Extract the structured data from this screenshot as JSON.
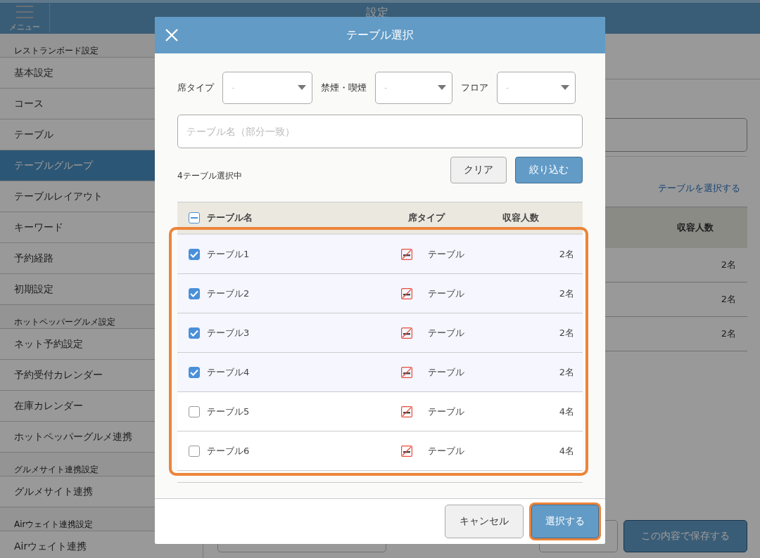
{
  "app_bar": {
    "menu_label": "メニュー",
    "title": "設定"
  },
  "sidebar": {
    "sections": [
      {
        "title": "レストランボード設定",
        "items": [
          {
            "label": "基本設定",
            "selected": false
          },
          {
            "label": "コース",
            "selected": false
          },
          {
            "label": "テーブル",
            "selected": false
          },
          {
            "label": "テーブルグループ",
            "selected": true
          },
          {
            "label": "テーブルレイアウト",
            "selected": false
          },
          {
            "label": "キーワード",
            "selected": false
          },
          {
            "label": "予約経路",
            "selected": false
          },
          {
            "label": "初期設定",
            "selected": false
          }
        ]
      },
      {
        "title": "ホットペッパーグルメ設定",
        "items": [
          {
            "label": "ネット予約設定",
            "selected": false
          },
          {
            "label": "予約受付カレンダー",
            "selected": false
          },
          {
            "label": "在庫カレンダー",
            "selected": false
          },
          {
            "label": "ホットペッパーグルメ連携",
            "selected": false
          }
        ]
      },
      {
        "title": "グルメサイト連携設定",
        "items": [
          {
            "label": "グルメサイト連携",
            "selected": false
          }
        ]
      },
      {
        "title": "Airウェイト連携設定",
        "items": [
          {
            "label": "Airウェイト連携",
            "selected": false
          }
        ]
      }
    ]
  },
  "background": {
    "link": "テーブルを選択する",
    "table_header": "収容人数",
    "rows": [
      "2名",
      "2名",
      "2名"
    ],
    "save_button": "この内容で保存する"
  },
  "dialog": {
    "title": "テーブル選択",
    "filters": [
      {
        "label": "席タイプ",
        "value": "-"
      },
      {
        "label": "禁煙・喫煙",
        "value": "-"
      },
      {
        "label": "フロア",
        "value": "-"
      }
    ],
    "search": {
      "placeholder": "テーブル名（部分一致）"
    },
    "selection_count": "4テーブル選択中",
    "clear_button": "クリア",
    "filter_button": "絞り込む",
    "table": {
      "select_all": {
        "indeterminate": true
      },
      "columns": [
        "テーブル名",
        "席タイプ",
        "収容人数"
      ],
      "highlighted": true,
      "rows": [
        {
          "checked": true,
          "name": "テーブル1",
          "no_smoking": true,
          "seat_type": "テーブル",
          "capacity": "2名"
        },
        {
          "checked": true,
          "name": "テーブル2",
          "no_smoking": true,
          "seat_type": "テーブル",
          "capacity": "2名"
        },
        {
          "checked": true,
          "name": "テーブル3",
          "no_smoking": true,
          "seat_type": "テーブル",
          "capacity": "2名"
        },
        {
          "checked": true,
          "name": "テーブル4",
          "no_smoking": true,
          "seat_type": "テーブル",
          "capacity": "2名"
        },
        {
          "checked": false,
          "name": "テーブル5",
          "no_smoking": true,
          "seat_type": "テーブル",
          "capacity": "4名"
        },
        {
          "checked": false,
          "name": "テーブル6",
          "no_smoking": true,
          "seat_type": "テーブル",
          "capacity": "4名"
        }
      ]
    },
    "cancel_button": "キャンセル",
    "select_button": {
      "label": "選択する",
      "highlighted": true
    }
  }
}
